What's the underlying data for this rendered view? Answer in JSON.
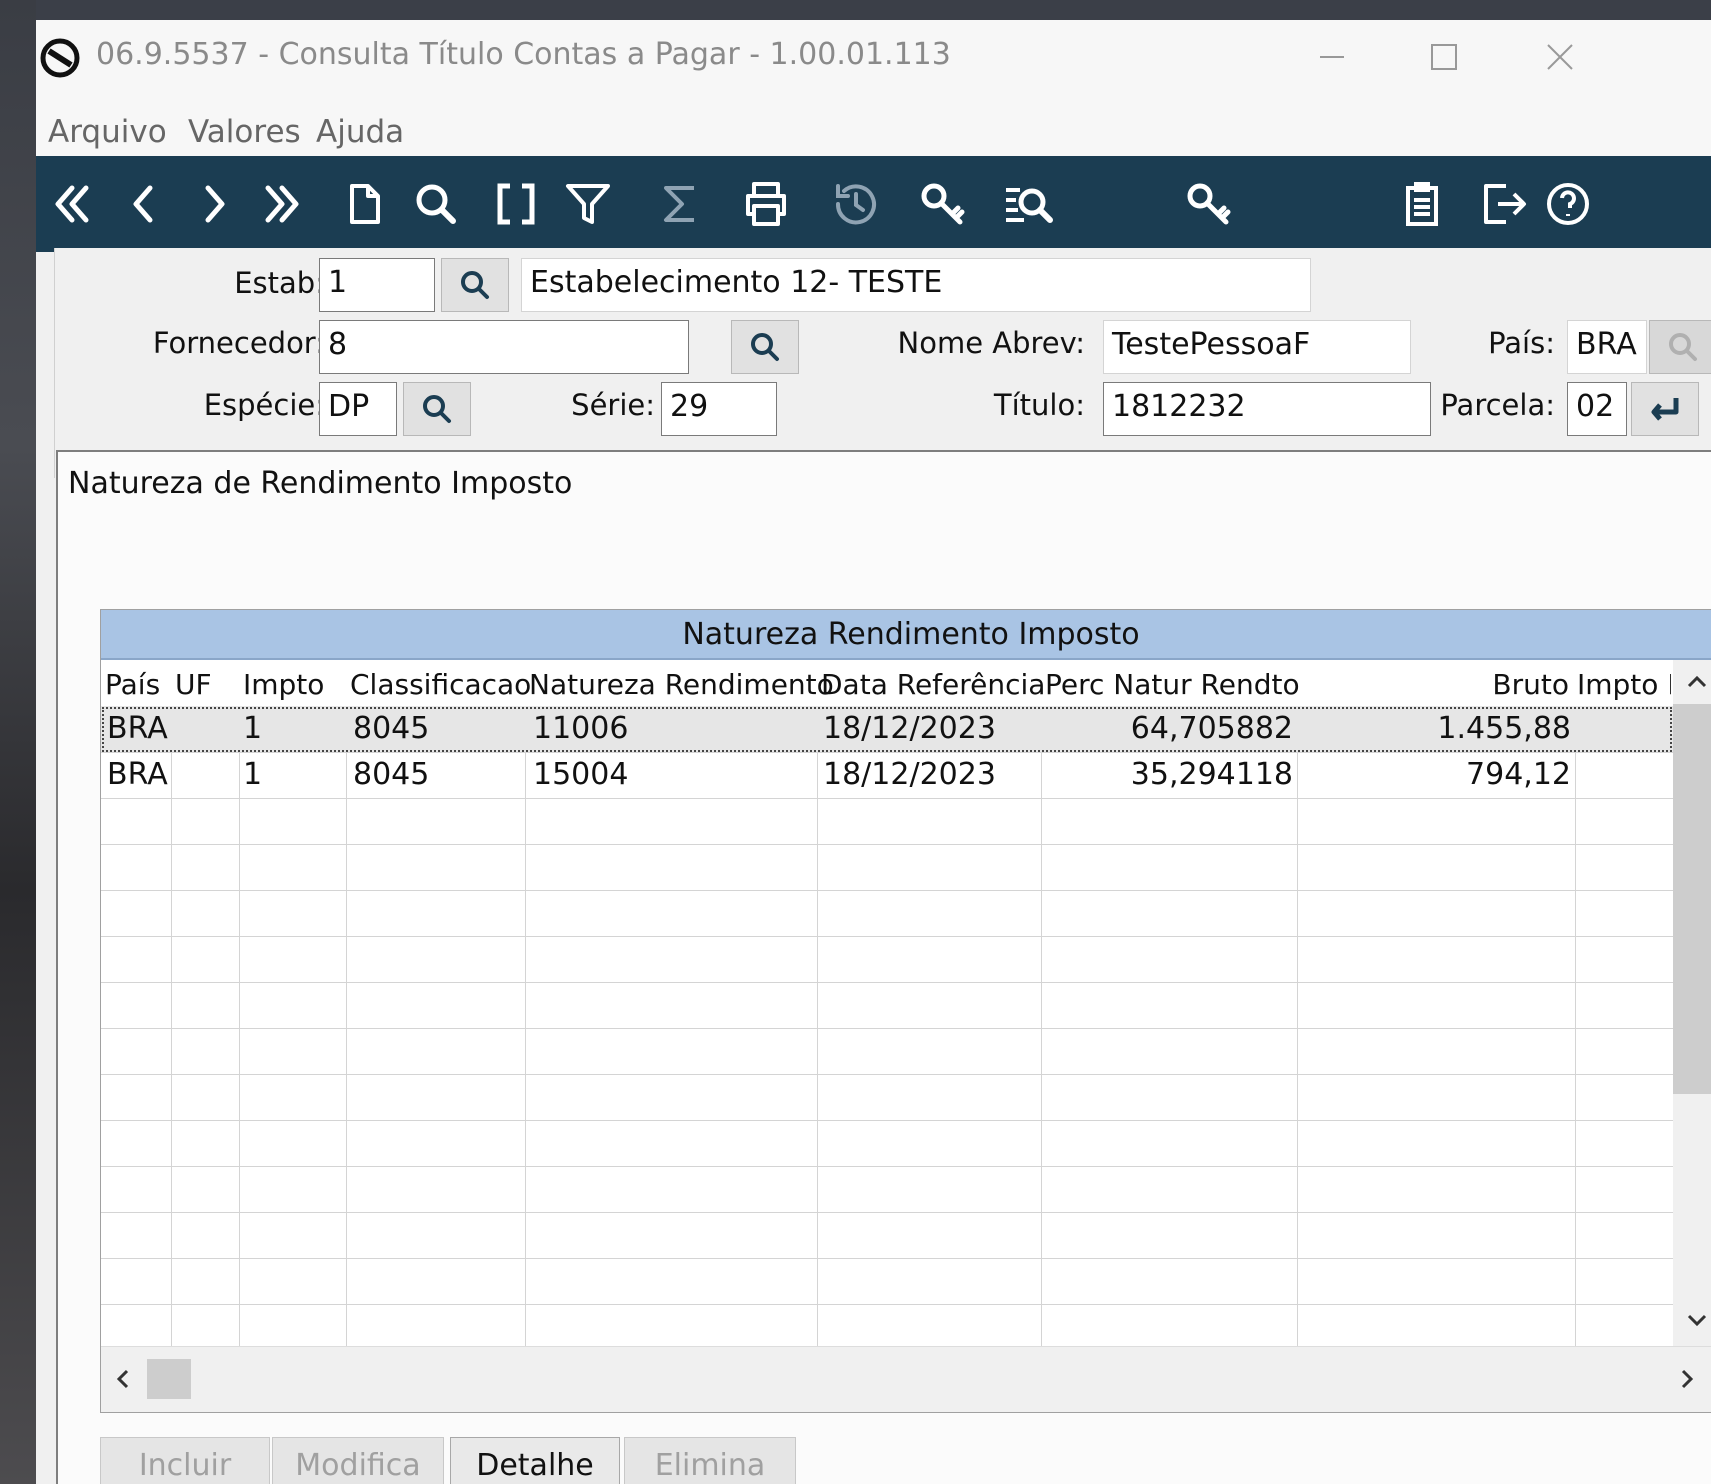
{
  "window": {
    "title": "06.9.5537 - Consulta Título Contas a Pagar - 1.00.01.113"
  },
  "menu": {
    "items": [
      "Arquivo",
      "Valores",
      "Ajuda"
    ]
  },
  "toolbar": {
    "icons": [
      "first-icon",
      "previous-icon",
      "next-icon",
      "last-icon",
      "new-document-icon",
      "search-icon",
      "brackets-icon",
      "filter-icon",
      "sum-icon",
      "print-icon",
      "history-icon",
      "key-search-icon",
      "list-search-icon",
      "key-icon",
      "clipboard-icon",
      "exit-icon",
      "help-icon"
    ]
  },
  "form": {
    "estab_label": "Estab:",
    "estab_value": "1",
    "estab_desc": "Estabelecimento 12- TESTE",
    "fornecedor_label": "Fornecedor:",
    "fornecedor_value": "8",
    "nome_abrev_label": "Nome Abrev:",
    "nome_abrev_value": "TestePessoaF",
    "pais_label": "País:",
    "pais_value": "BRA",
    "especie_label": "Espécie:",
    "especie_value": "DP",
    "serie_label": "Série:",
    "serie_value": "29",
    "titulo_label": "Título:",
    "titulo_value": "1812232",
    "parcela_label": "Parcela:",
    "parcela_value": "02"
  },
  "dialog": {
    "title": "Natureza de Rendimento Imposto",
    "grid_title": "Natureza Rendimento Imposto",
    "columns": [
      "País",
      "UF",
      "Impto",
      "Classificacao",
      "Natureza Rendimento",
      "Data Referência",
      "Perc Natur Rendto",
      "Bruto",
      "Impto B"
    ],
    "rows": [
      {
        "pais": "BRA",
        "uf": "",
        "impto": "1",
        "classificacao": "8045",
        "natureza": "11006",
        "data": "18/12/2023",
        "perc": "64,705882",
        "bruto": "1.455,88",
        "impto_b": ""
      },
      {
        "pais": "BRA",
        "uf": "",
        "impto": "1",
        "classificacao": "8045",
        "natureza": "15004",
        "data": "18/12/2023",
        "perc": "35,294118",
        "bruto": "794,12",
        "impto_b": ""
      }
    ],
    "buttons": {
      "incluir": "Incluir",
      "modifica": "Modifica",
      "detalhe": "Detalhe",
      "elimina": "Elimina"
    }
  }
}
